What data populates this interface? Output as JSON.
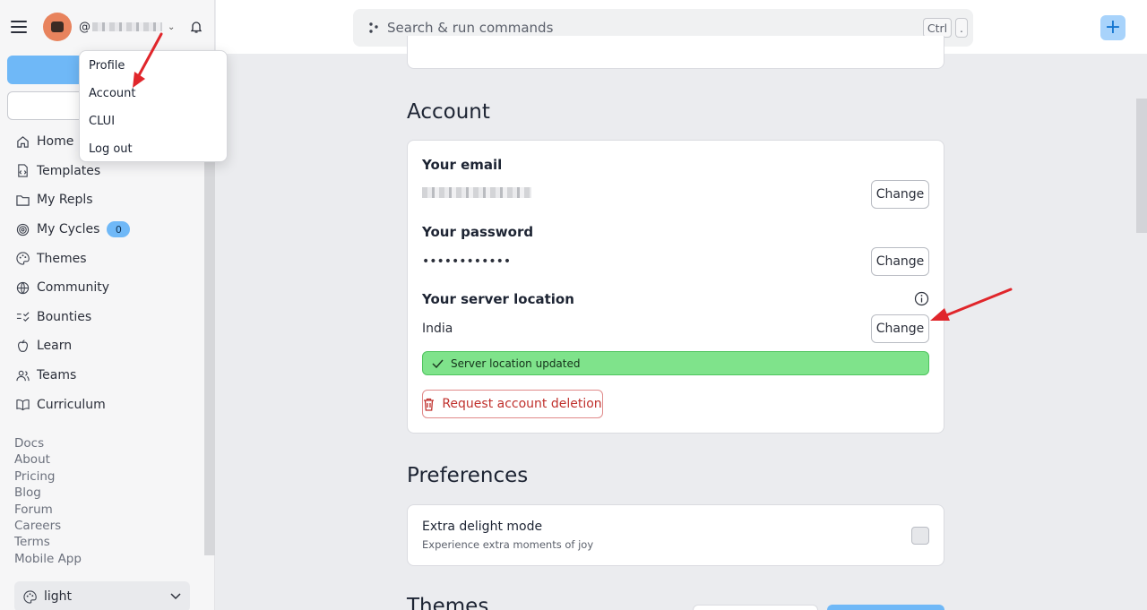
{
  "sidebar": {
    "username_prefix": "@",
    "create_label": "+",
    "nav": [
      {
        "label": "Home",
        "icon": "home-icon"
      },
      {
        "label": "Templates",
        "icon": "templates-icon"
      },
      {
        "label": "My Repls",
        "icon": "folder-icon"
      },
      {
        "label": "My Cycles",
        "icon": "cycles-icon",
        "badge": "0"
      },
      {
        "label": "Themes",
        "icon": "palette-icon"
      },
      {
        "label": "Community",
        "icon": "globe-icon"
      },
      {
        "label": "Bounties",
        "icon": "bounties-icon"
      },
      {
        "label": "Learn",
        "icon": "learn-icon"
      },
      {
        "label": "Teams",
        "icon": "teams-icon"
      },
      {
        "label": "Curriculum",
        "icon": "book-icon"
      }
    ],
    "links": [
      "Docs",
      "About",
      "Pricing",
      "Blog",
      "Forum",
      "Careers",
      "Terms",
      "Mobile App"
    ],
    "theme_value": "light"
  },
  "user_menu": {
    "items": [
      "Profile",
      "Account",
      "CLUI",
      "Log out"
    ]
  },
  "topbar": {
    "search_placeholder": "Search & run commands",
    "kbd_ctrl": "Ctrl",
    "kbd_dot": ".",
    "plus_label": "+"
  },
  "account": {
    "title": "Account",
    "email_label": "Your email",
    "password_label": "Your password",
    "password_value": "••••••••••••",
    "server_label": "Your server location",
    "server_value": "India",
    "change_label": "Change",
    "success_message": "Server location updated",
    "delete_label": "Request account deletion"
  },
  "preferences": {
    "title": "Preferences",
    "delight_title": "Extra delight mode",
    "delight_desc": "Experience extra moments of joy",
    "delight_checked": false
  },
  "themes": {
    "title": "Themes"
  },
  "colors": {
    "accent": "#6fb8f7",
    "success": "#7fe38b",
    "danger": "#c0312d",
    "annotation_arrow": "#e0262b"
  }
}
